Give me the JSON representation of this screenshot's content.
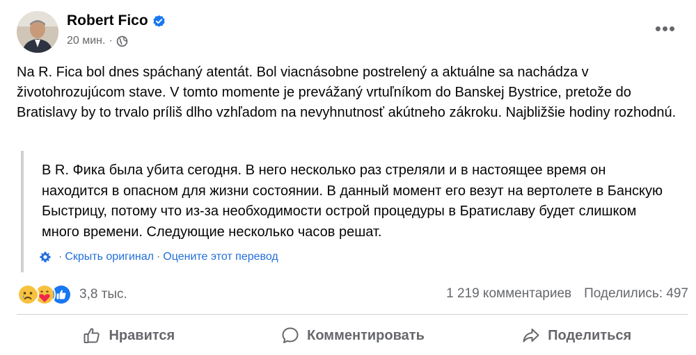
{
  "post": {
    "author": "Robert Fico",
    "time": "20 мин.",
    "more_label": "•••",
    "text": "Na R. Fica bol dnes spáchaný atentát. Bol viacnásobne postrelený a aktuálne sa nachádza v životohrozujúcom stave. V tomto momente je prevážaný vrtuľníkom do Banskej Bystrice, pretože do Bratislavy by to trvalo príliš dlho vzhľadom na nevyhnutnosť akútneho zákroku. Najbližšie hodiny rozhodnú."
  },
  "translation": {
    "text": "В R. Фика была убита сегодня. В него несколько раз стреляли и в настоящее время он находится в опасном для жизни состоянии. В данный момент его везут на вертолете в Банскую Быстрицу, потому что из-за необходимости острой процедуры в Братиславу будет слишком много времени. Следующие несколько часов решат.",
    "hide_original": "Скрыть оригинал",
    "rate_translation": "Оцените этот перевод"
  },
  "stats": {
    "reactions_count": "3,8 тыс.",
    "comments": "1 219 комментариев",
    "shares": "Поделились: 497"
  },
  "actions": {
    "like": "Нравится",
    "comment": "Комментировать",
    "share": "Поделиться"
  },
  "icons": {
    "verified": "verified-badge-icon",
    "audience": "globe-icon",
    "translation": "gear-icon",
    "reactions": [
      "sad-reaction-icon",
      "care-reaction-icon",
      "like-reaction-icon"
    ]
  },
  "colors": {
    "accent": "#216fdb",
    "verified": "#1877f2",
    "secondary_text": "#65676b"
  }
}
